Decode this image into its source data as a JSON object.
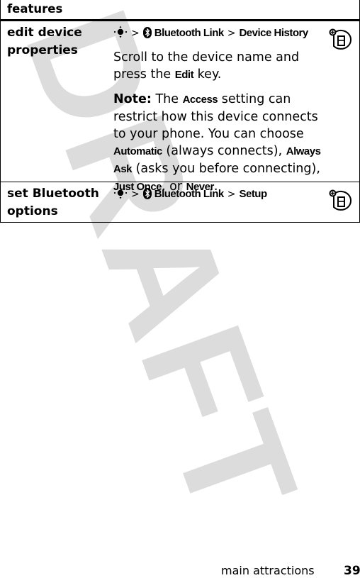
{
  "watermark": "DRAFT",
  "table": {
    "header": "features",
    "rows": [
      {
        "feature": "edit device properties",
        "path": {
          "nav_icon": "nav-key-icon",
          "separator": ">",
          "bt_icon": "bluetooth-icon",
          "items": [
            "Bluetooth Link",
            "Device History"
          ]
        },
        "instruction": {
          "before": "Scroll to the device name and press the ",
          "key": "Edit",
          "after": " key."
        },
        "note": {
          "label": "Note:",
          "t1": " The ",
          "access": "Access",
          "t2": " setting can restrict how this device connects to your phone. You can choose ",
          "automatic": "Automatic",
          "t3": " (always connects), ",
          "always_ask": "Always Ask",
          "t4": " (asks you before connecting), ",
          "just_once": "Just Once",
          "t5": ", or ",
          "never": "Never",
          "t6": "."
        },
        "feature_icon": "network-feature-icon"
      },
      {
        "feature": "set Bluetooth options",
        "path": {
          "nav_icon": "nav-key-icon",
          "separator": ">",
          "bt_icon": "bluetooth-icon",
          "items": [
            "Bluetooth Link",
            "Setup"
          ]
        },
        "feature_icon": "network-feature-icon"
      }
    ]
  },
  "footer": {
    "section": "main attractions",
    "page_number": "39"
  }
}
